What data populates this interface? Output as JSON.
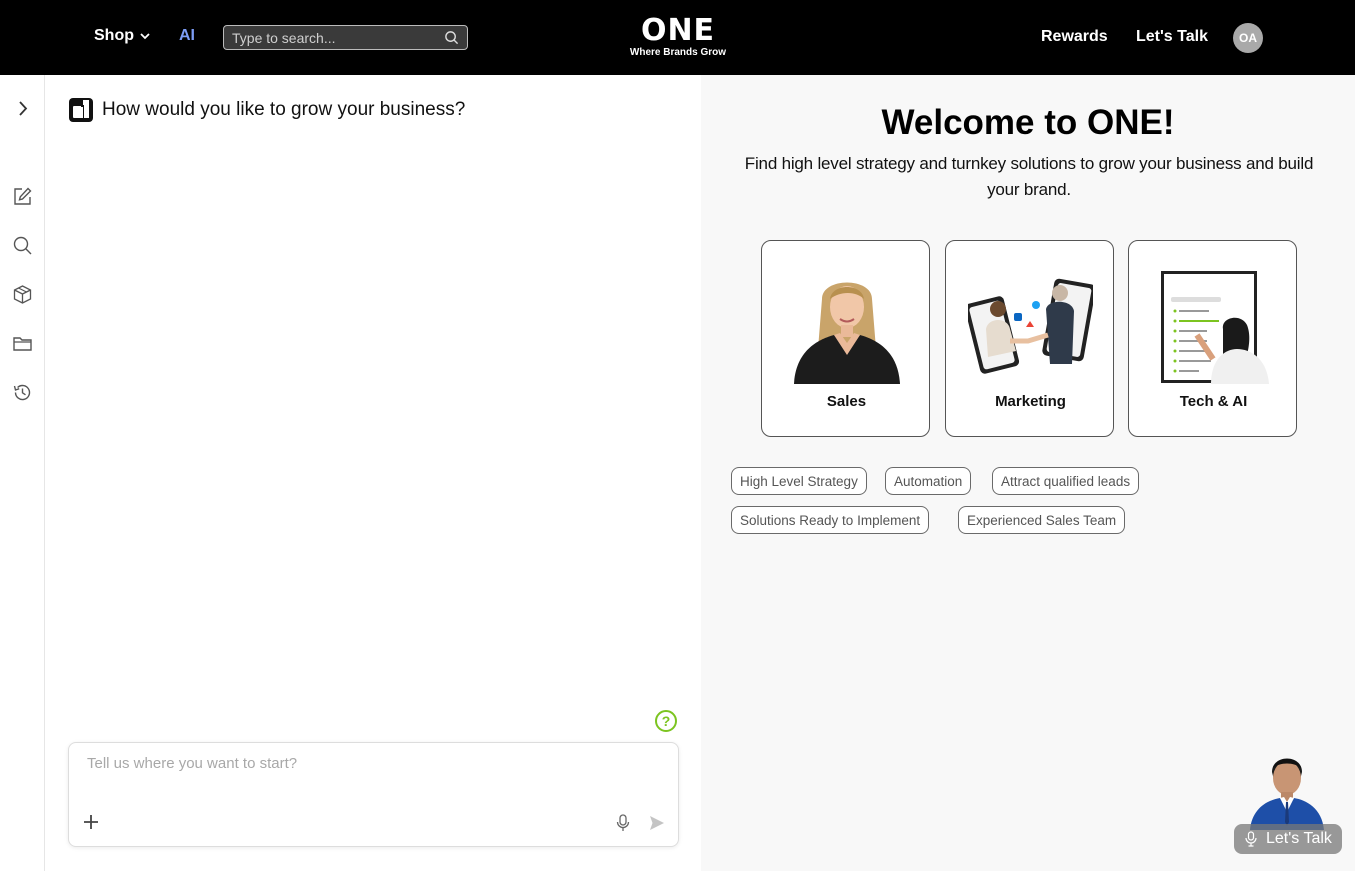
{
  "header": {
    "shop_label": "Shop",
    "ai_label": "AI",
    "search_placeholder": "Type to search...",
    "logo_word": "ONE",
    "logo_tagline": "Where Brands Grow",
    "rewards_label": "Rewards",
    "lets_talk_label": "Let's Talk",
    "avatar_initials": "OA"
  },
  "sidebar": {
    "icons": [
      "chevron-right-icon",
      "edit-icon",
      "search-icon",
      "cube-icon",
      "folder-icon",
      "history-icon"
    ]
  },
  "chat": {
    "title": "How would you like to grow your business?",
    "help_glyph": "?",
    "input_placeholder": "Tell us where you want to start?"
  },
  "welcome": {
    "title": "Welcome to ONE!",
    "subtitle": "Find high level strategy and turnkey solutions to grow your business and build your brand.",
    "cards": [
      {
        "label": "Sales"
      },
      {
        "label": "Marketing"
      },
      {
        "label": "Tech & AI"
      }
    ],
    "chips": [
      "High Level Strategy",
      "Automation",
      "Attract qualified leads",
      "Solutions Ready to Implement",
      "Experienced Sales Team"
    ]
  },
  "agent": {
    "button_label": "Let's Talk"
  },
  "colors": {
    "header_bg": "#000000",
    "ai_accent": "#7c9cf5",
    "help_green": "#7cc420",
    "pane_bg": "#f8f8f8"
  }
}
